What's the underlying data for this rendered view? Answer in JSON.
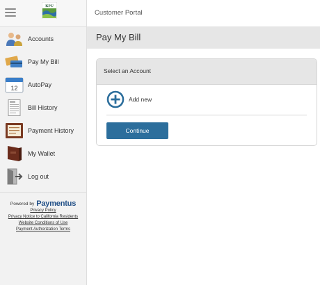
{
  "sidebar": {
    "logo_text": "KPU",
    "items": [
      {
        "label": "Accounts",
        "icon": "accounts-icon"
      },
      {
        "label": "Pay My Bill",
        "icon": "pay-bill-icon"
      },
      {
        "label": "AutoPay",
        "icon": "calendar-icon"
      },
      {
        "label": "Bill History",
        "icon": "invoice-icon"
      },
      {
        "label": "Payment History",
        "icon": "payment-history-icon"
      },
      {
        "label": "My Wallet",
        "icon": "wallet-icon"
      },
      {
        "label": "Log out",
        "icon": "logout-icon"
      }
    ],
    "footer": {
      "powered_by": "Powered by",
      "brand": "Paymentus",
      "links": [
        "Privacy Policy",
        "Privacy Notice to California Residents",
        "Website Conditions of Use",
        "Payment Authorization Terms"
      ]
    }
  },
  "header": {
    "title": "Customer Portal"
  },
  "page": {
    "title": "Pay My Bill",
    "card": {
      "header": "Select an Account",
      "add_new": "Add new",
      "continue": "Continue"
    }
  },
  "colors": {
    "accent": "#2c6e9c",
    "brand": "#1f4e86",
    "sidebar_bg": "#f2f2f2",
    "header_bg": "#e6e6e6"
  }
}
